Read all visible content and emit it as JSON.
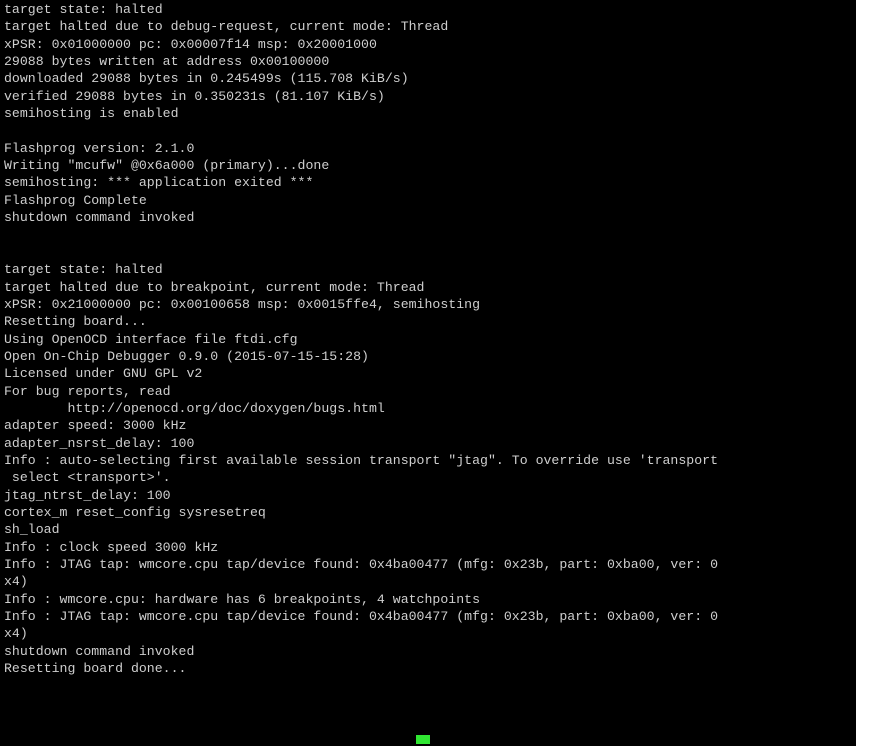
{
  "terminal": {
    "background_color": "#000000",
    "text_color": "#cfcfcf",
    "cursor_color": "#30e632",
    "lines": [
      "target state: halted",
      "target halted due to debug-request, current mode: Thread",
      "xPSR: 0x01000000 pc: 0x00007f14 msp: 0x20001000",
      "29088 bytes written at address 0x00100000",
      "downloaded 29088 bytes in 0.245499s (115.708 KiB/s)",
      "verified 29088 bytes in 0.350231s (81.107 KiB/s)",
      "semihosting is enabled",
      "",
      "Flashprog version: 2.1.0",
      "Writing \"mcufw\" @0x6a000 (primary)...done",
      "semihosting: *** application exited ***",
      "Flashprog Complete",
      "shutdown command invoked",
      "",
      "",
      "target state: halted",
      "target halted due to breakpoint, current mode: Thread",
      "xPSR: 0x21000000 pc: 0x00100658 msp: 0x0015ffe4, semihosting",
      "Resetting board...",
      "Using OpenOCD interface file ftdi.cfg",
      "Open On-Chip Debugger 0.9.0 (2015-07-15-15:28)",
      "Licensed under GNU GPL v2",
      "For bug reports, read",
      "        http://openocd.org/doc/doxygen/bugs.html",
      "adapter speed: 3000 kHz",
      "adapter_nsrst_delay: 100",
      "Info : auto-selecting first available session transport \"jtag\". To override use 'transport",
      " select <transport>'.",
      "jtag_ntrst_delay: 100",
      "cortex_m reset_config sysresetreq",
      "sh_load",
      "Info : clock speed 3000 kHz",
      "Info : JTAG tap: wmcore.cpu tap/device found: 0x4ba00477 (mfg: 0x23b, part: 0xba00, ver: 0",
      "x4)",
      "Info : wmcore.cpu: hardware has 6 breakpoints, 4 watchpoints",
      "Info : JTAG tap: wmcore.cpu tap/device found: 0x4ba00477 (mfg: 0x23b, part: 0xba00, ver: 0",
      "x4)",
      "shutdown command invoked",
      "Resetting board done..."
    ]
  }
}
